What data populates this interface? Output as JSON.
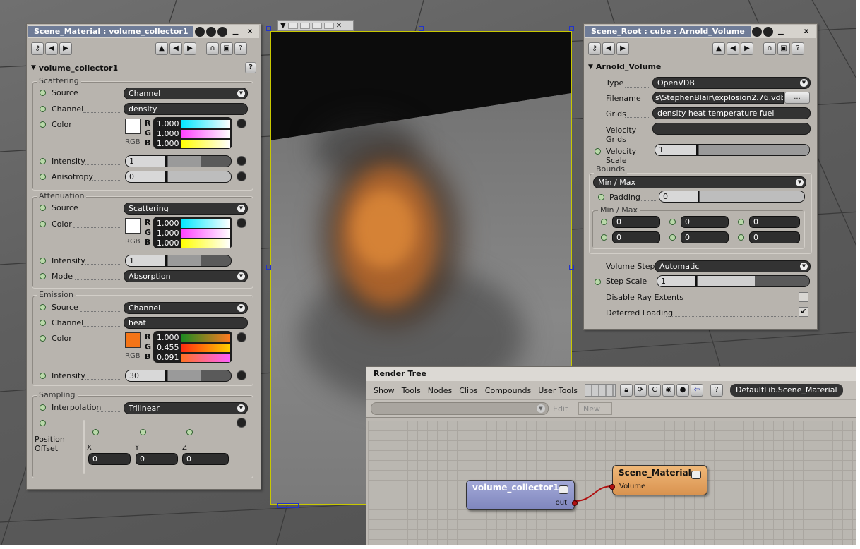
{
  "material_panel": {
    "title": "Scene_Material : volume_collector1",
    "node_name": "volume_collector1",
    "help": "?",
    "close": "x",
    "scattering": {
      "group": "Scattering",
      "source_label": "Source",
      "source_value": "Channel",
      "channel_label": "Channel",
      "channel_value": "density",
      "color_label": "Color",
      "rgb": "RGB",
      "r": "1.000",
      "g": "1.000",
      "b": "1.000",
      "swatch": "#ffffff",
      "intensity_label": "Intensity",
      "intensity": "1",
      "anisotropy_label": "Anisotropy",
      "anisotropy": "0"
    },
    "attenuation": {
      "group": "Attenuation",
      "source_label": "Source",
      "source_value": "Scattering",
      "color_label": "Color",
      "rgb": "RGB",
      "r": "1.000",
      "g": "1.000",
      "b": "1.000",
      "swatch": "#ffffff",
      "intensity_label": "Intensity",
      "intensity": "1",
      "mode_label": "Mode",
      "mode_value": "Absorption"
    },
    "emission": {
      "group": "Emission",
      "source_label": "Source",
      "source_value": "Channel",
      "channel_label": "Channel",
      "channel_value": "heat",
      "color_label": "Color",
      "rgb": "RGB",
      "r": "1.000",
      "g": "0.455",
      "b": "0.091",
      "swatch": "#f47416",
      "intensity_label": "Intensity",
      "intensity": "30"
    },
    "sampling": {
      "group": "Sampling",
      "interpolation_label": "Interpolation",
      "interpolation_value": "Trilinear",
      "position_offset_label": "Position Offset",
      "x_label": "X",
      "y_label": "Y",
      "z_label": "Z",
      "x": "0",
      "y": "0",
      "z": "0"
    }
  },
  "volume_panel": {
    "title": "Scene_Root : cube : Arnold_Volume",
    "node_name": "Arnold_Volume",
    "help": "?",
    "close": "x",
    "type_label": "Type",
    "type_value": "OpenVDB",
    "filename_label": "Filename",
    "filename_value": "s\\StephenBlair\\explosion2.76.vdb",
    "browse": "...",
    "grids_label": "Grids",
    "grids_value": "density heat temperature fuel",
    "velocity_grids_label": "Velocity Grids",
    "velocity_grids_value": "",
    "velocity_scale_label": "Velocity Scale",
    "velocity_scale": "1",
    "bounds_group": "Bounds",
    "bounds_value": "Min / Max",
    "padding_label": "Padding",
    "padding": "0",
    "minmax_group": "Min / Max",
    "minmax_values": [
      "0",
      "0",
      "0",
      "0",
      "0",
      "0"
    ],
    "volume_step_label": "Volume Step",
    "volume_step_value": "Automatic",
    "step_scale_label": "Step Scale",
    "step_scale": "1",
    "disable_ray_label": "Disable Ray Extents",
    "disable_ray_checked": false,
    "deferred_label": "Deferred Loading",
    "deferred_checked": true,
    "check_mark": "✔"
  },
  "render_tree": {
    "title": "Render Tree",
    "menu": [
      "Show",
      "Tools",
      "Nodes",
      "Clips",
      "Compounds",
      "User Tools"
    ],
    "library": "DefaultLib.Scene_Material",
    "edit": "Edit",
    "new": "New",
    "help": "?",
    "node_collector": {
      "title": "volume_collector1",
      "port": "out"
    },
    "node_material": {
      "title": "Scene_Material",
      "port": "Volume"
    }
  },
  "colors": {
    "panel": "#b8b4ae",
    "title": "#6f7c97",
    "collector_node": "#8a91c4",
    "material_node": "#e0a060",
    "link": "#b01010"
  }
}
